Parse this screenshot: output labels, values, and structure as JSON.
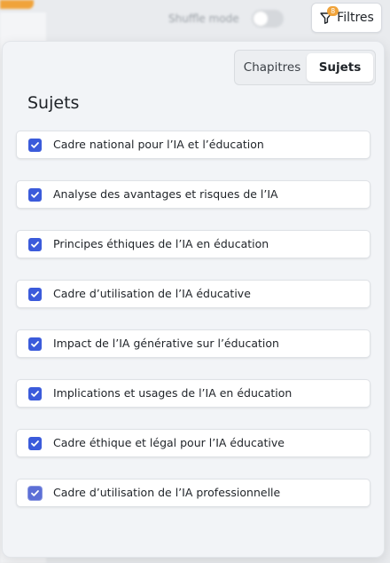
{
  "background": {
    "shuffle_label": "Shuffle mode"
  },
  "filter_button": {
    "label": "Filtres",
    "badge": "8",
    "icon": "filter-icon"
  },
  "panel": {
    "tabs": [
      {
        "label": "Chapitres",
        "active": false
      },
      {
        "label": "Sujets",
        "active": true
      }
    ],
    "title": "Sujets",
    "items": [
      {
        "label": "Cadre national pour l’IA et l’éducation",
        "checked": true
      },
      {
        "label": "Analyse des avantages et risques de l’IA",
        "checked": true
      },
      {
        "label": "Principes éthiques de l’IA en éducation",
        "checked": true
      },
      {
        "label": "Cadre d’utilisation de l’IA éducative",
        "checked": true
      },
      {
        "label": "Impact de l’IA générative sur l’éducation",
        "checked": true
      },
      {
        "label": "Implications et usages de l’IA en éducation",
        "checked": true
      },
      {
        "label": "Cadre éthique et légal pour l’IA éducative",
        "checked": true
      },
      {
        "label": "Cadre d’utilisation de l’IA professionnelle",
        "checked": true
      }
    ]
  },
  "colors": {
    "accent": "#3b5bdb",
    "badge": "#f0a33a"
  }
}
